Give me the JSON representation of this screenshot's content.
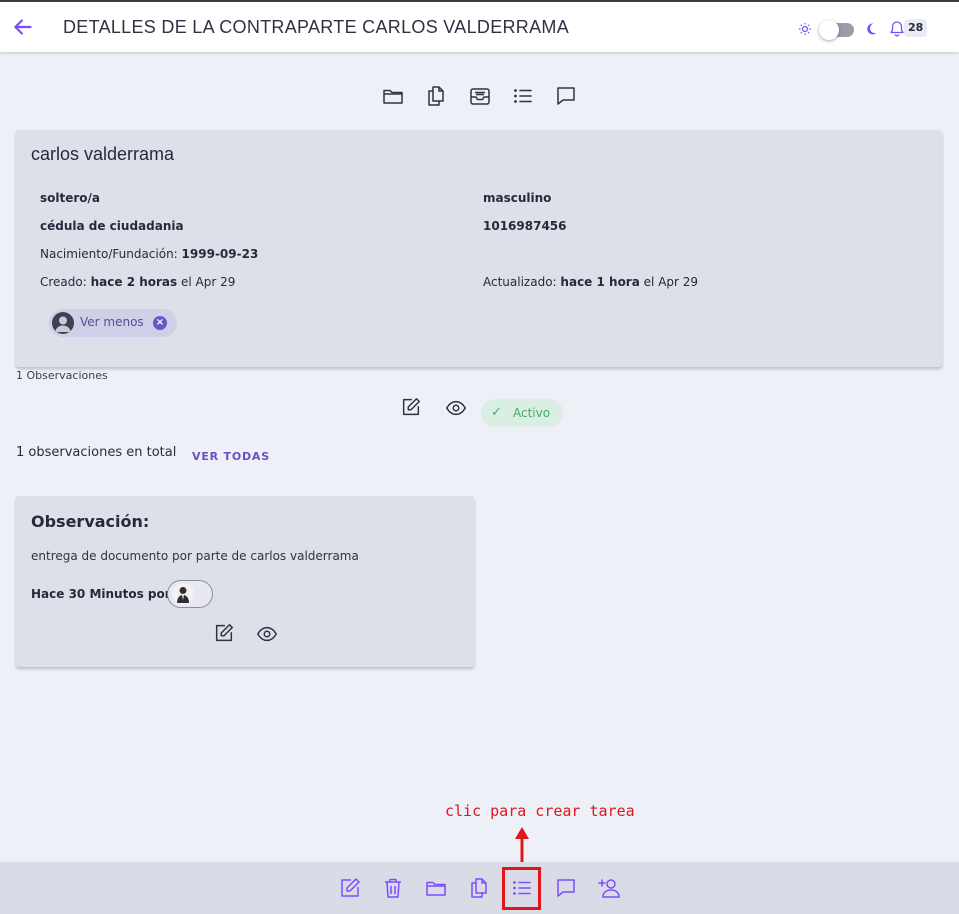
{
  "header": {
    "title": "DETALLES DE LA CONTRAPARTE CARLOS VALDERRAMA",
    "notification_count": "28",
    "accent_color": "#7c4dff",
    "icons": [
      "arrow-left-icon",
      "sun-icon",
      "moon-icon",
      "bell-icon"
    ]
  },
  "top_toolbar": {
    "icons": [
      "folder-icon",
      "documents-icon",
      "inbox-icon",
      "task-list-icon",
      "comment-icon"
    ]
  },
  "profile": {
    "name": "carlos valderrama",
    "marital_status": "soltero/a",
    "gender": "masculino",
    "id_type": "cédula de ciudadania",
    "id_number": "1016987456",
    "birth_label": "Nacimiento/Fundación:",
    "birth_date": "1999-09-23",
    "created_label": "Creado:",
    "created_rel": "hace 2 horas",
    "created_date": "el Apr 29",
    "updated_label": "Actualizado:",
    "updated_rel": "hace 1 hora",
    "updated_date": "el Apr 29",
    "chip_label": "Ver menos",
    "chip_close": "×"
  },
  "observations_summary": {
    "count_label": "1 Observaciones",
    "status": "Activo",
    "status_icon": "✓",
    "total_text": "1 observaciones en total",
    "view_all": "VER TODAS"
  },
  "observation": {
    "title": "Observación:",
    "description": "entrega de documento por parte de carlos valderrama",
    "time_by": "Hace 30 Minutos por"
  },
  "annotation": {
    "hint": "clic para crear tarea",
    "highlight_color": "#e0161b"
  },
  "bottom_toolbar": {
    "icons": [
      "edit-icon",
      "trash-icon",
      "folder-icon",
      "documents-icon",
      "task-list-icon",
      "comment-icon",
      "add-user-icon"
    ]
  }
}
